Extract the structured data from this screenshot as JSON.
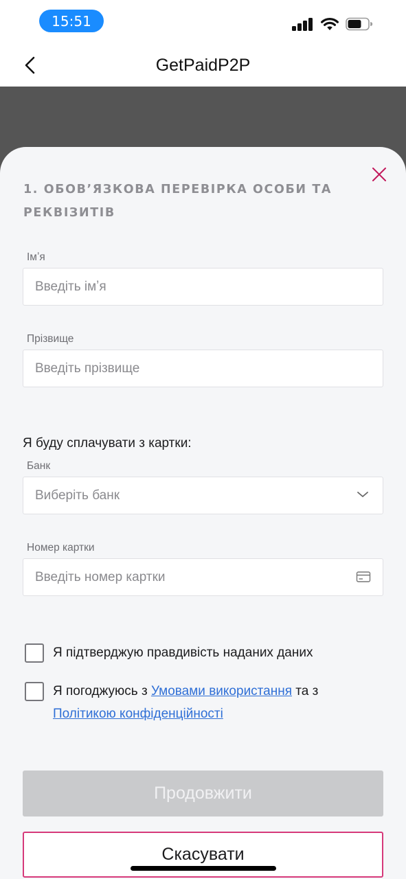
{
  "status_bar": {
    "time": "15:51"
  },
  "nav": {
    "title": "GetPaidP2P",
    "back_icon": "chevron-left-icon"
  },
  "sheet": {
    "close_icon": "close-icon",
    "close_color": "#c2185b",
    "section_title": "1. Обов’язкова перевірка особи та реквізитів",
    "first_name": {
      "label": "Імʼя",
      "placeholder": "Введіть імʼя",
      "value": ""
    },
    "last_name": {
      "label": "Прізвище",
      "placeholder": "Введіть прізвище",
      "value": ""
    },
    "pay_from_label": "Я буду сплачувати з картки:",
    "bank": {
      "label": "Банк",
      "selected": "Виберіть банк",
      "icon": "chevron-down-icon"
    },
    "card_number": {
      "label": "Номер картки",
      "placeholder": "Введіть номер картки",
      "icon": "credit-card-icon",
      "value": ""
    },
    "confirm_checkbox": {
      "text": "Я підтверджую правдивість наданих даних",
      "checked": false
    },
    "terms_checkbox": {
      "text_prefix": "Я погоджуюсь з",
      "terms_link": "Умовами використання",
      "text_middle": "та з",
      "privacy_link": "Політикою конфіденційності",
      "checked": false
    },
    "continue_button": "Продовжити",
    "cancel_button": "Скасувати"
  },
  "colors": {
    "accent": "#d6397a",
    "link": "#2f6fd6",
    "time_pill": "#1a8cff",
    "disabled_button": "#c9cacc"
  }
}
